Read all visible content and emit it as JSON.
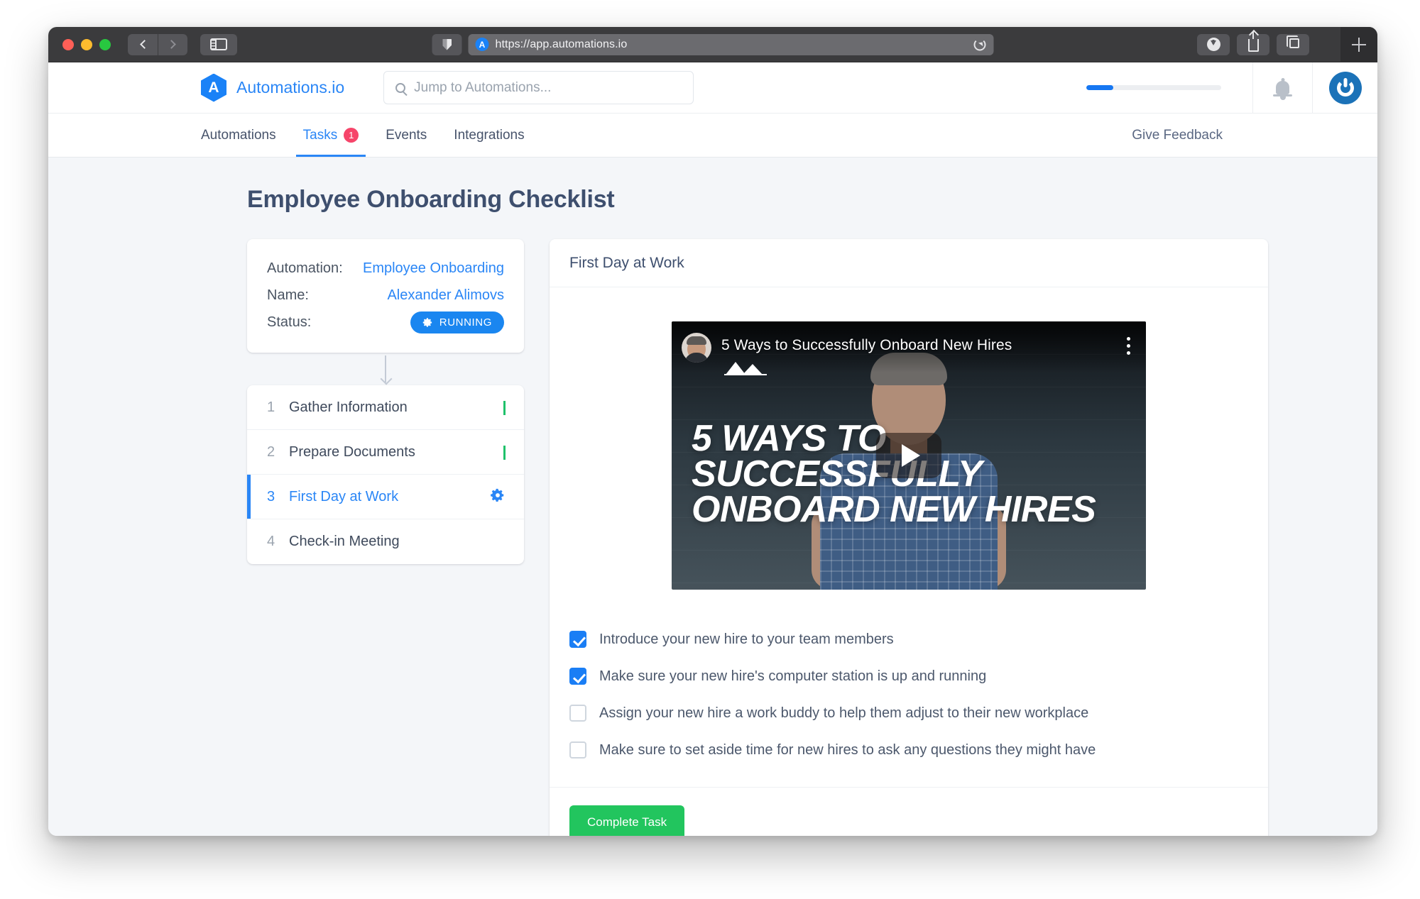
{
  "browser": {
    "url": "https://app.automations.io",
    "favicon_letter": "A",
    "back_icon": "back-chevron-icon",
    "forward_icon": "forward-chevron-icon",
    "sidebar_icon": "sidebar-toggle-icon",
    "shield_icon": "privacy-shield-icon",
    "reload_icon": "reload-icon",
    "download_icon": "download-icon",
    "share_icon": "share-icon",
    "tabs_icon": "tab-overview-icon",
    "newtab_icon": "plus-icon"
  },
  "header": {
    "brand_mark": "A",
    "brand_name": "Automations.io",
    "search_placeholder": "Jump to Automations...",
    "search_icon": "search-icon",
    "progress_percent": 20,
    "bell_icon": "bell-icon",
    "avatar_icon": "power-logo-avatar"
  },
  "nav": {
    "tabs": [
      {
        "label": "Automations",
        "active": false,
        "badge": ""
      },
      {
        "label": "Tasks",
        "active": true,
        "badge": "1"
      },
      {
        "label": "Events",
        "active": false,
        "badge": ""
      },
      {
        "label": "Integrations",
        "active": false,
        "badge": ""
      }
    ],
    "feedback_label": "Give Feedback"
  },
  "page": {
    "title": "Employee Onboarding Checklist"
  },
  "info_card": {
    "rows": [
      {
        "label": "Automation:",
        "value": "Employee Onboarding"
      },
      {
        "label": "Name:",
        "value": "Alexander Alimovs"
      }
    ],
    "status_label": "Status:",
    "status_value": "RUNNING",
    "status_color": "#1a86f0",
    "status_icon": "gear-icon"
  },
  "steps": [
    {
      "num": "1",
      "label": "Gather Information",
      "state": "done",
      "icon": "check-icon"
    },
    {
      "num": "2",
      "label": "Prepare Documents",
      "state": "done",
      "icon": "check-icon"
    },
    {
      "num": "3",
      "label": "First Day at Work",
      "state": "active",
      "icon": "gear-icon"
    },
    {
      "num": "4",
      "label": "Check-in Meeting",
      "state": "pending",
      "icon": ""
    }
  ],
  "panel": {
    "title": "First Day at Work",
    "video": {
      "title": "5 Ways to Successfully Onboard New Hires",
      "overlay_line1": "5 WAYS TO",
      "overlay_line2": "SUCCESSFULLY",
      "overlay_line3": "ONBOARD NEW HIRES",
      "play_icon": "play-icon",
      "menu_icon": "kebab-menu-icon",
      "channel_icon": "channel-avatar",
      "watermark_icon": "mountains-icon"
    },
    "checklist": [
      {
        "checked": true,
        "label": "Introduce your new hire to your team members"
      },
      {
        "checked": true,
        "label": "Make sure your new hire's computer station is up and running"
      },
      {
        "checked": false,
        "label": "Assign your new hire a work buddy to help them adjust to their new workplace"
      },
      {
        "checked": false,
        "label": "Make sure to set aside time for new hires to ask any questions they might have"
      }
    ],
    "complete_button": "Complete Task",
    "complete_button_color": "#22c55e"
  },
  "colors": {
    "accent_blue": "#2a86f6",
    "success_green": "#1fc16b",
    "badge_red": "#f6456a",
    "page_bg": "#f4f6f9"
  }
}
